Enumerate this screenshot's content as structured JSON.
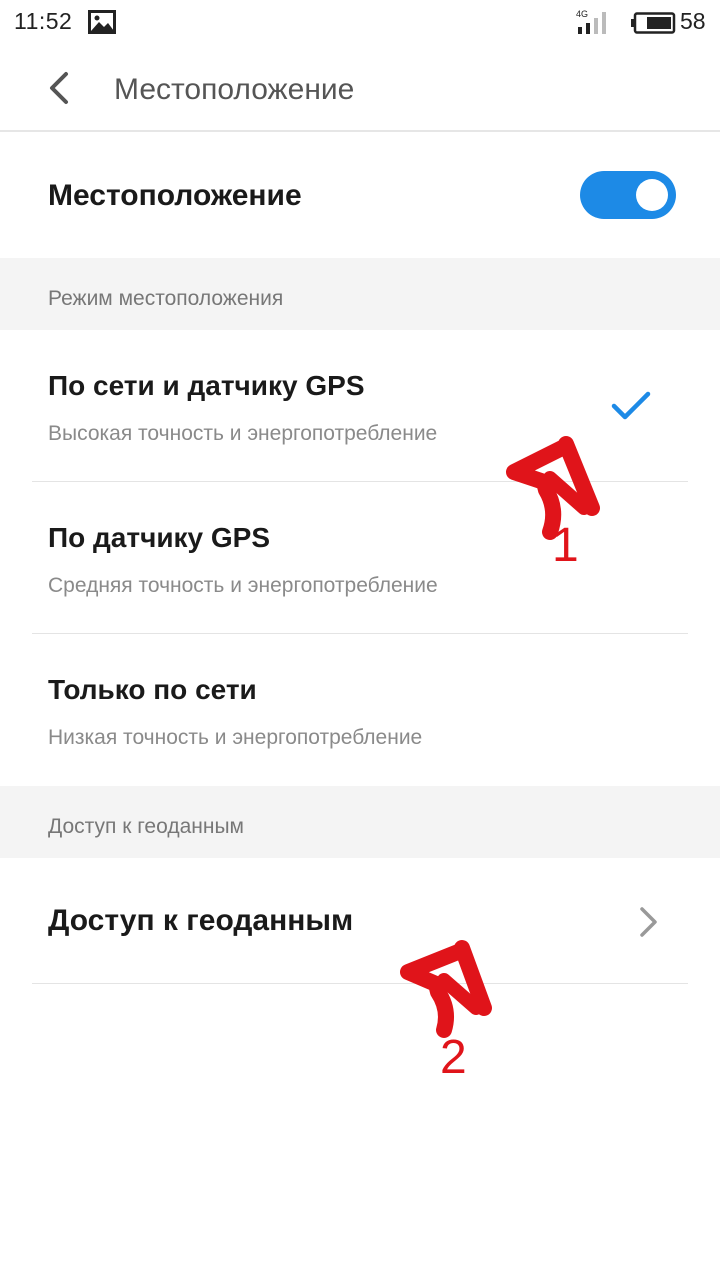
{
  "status_bar": {
    "time": "11:52",
    "network": "4G",
    "battery": "58"
  },
  "header": {
    "title": "Местоположение"
  },
  "location_toggle": {
    "label": "Местоположение",
    "enabled": true
  },
  "mode_section": {
    "title": "Режим местоположения"
  },
  "modes": [
    {
      "title": "По сети и датчику GPS",
      "subtitle": "Высокая точность и энергопотребление",
      "selected": true
    },
    {
      "title": "По датчику GPS",
      "subtitle": "Средняя точность и энергопотребление",
      "selected": false
    },
    {
      "title": "Только по сети",
      "subtitle": "Низкая точность и энергопотребление",
      "selected": false
    }
  ],
  "access_section": {
    "title": "Доступ к геоданным"
  },
  "access_item": {
    "label": "Доступ к геоданным"
  },
  "annotations": [
    {
      "number": "1"
    },
    {
      "number": "2"
    }
  ],
  "colors": {
    "accent": "#1d8ae6",
    "annotation": "#e0141a",
    "section_bg": "#f4f4f4"
  }
}
